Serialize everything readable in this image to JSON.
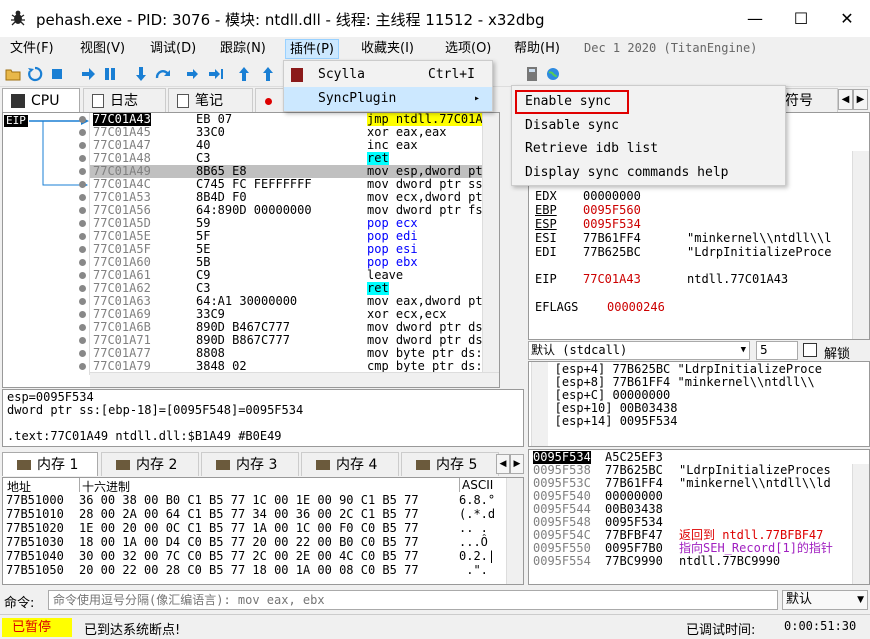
{
  "window": {
    "title": "pehash.exe - PID: 3076 - 模块: ntdll.dll - 线程: 主线程 11512 - x32dbg",
    "min": "—",
    "max": "☐",
    "close": "✕"
  },
  "menu": [
    "文件(F)",
    "视图(V)",
    "调试(D)",
    "跟踪(N)",
    "插件(P)",
    "收藏夹(I)",
    "选项(O)",
    "帮助(H)"
  ],
  "build_date": "Dec 1 2020 (TitanEngine)",
  "plugin_menu": {
    "items": [
      {
        "label": "Scylla",
        "shortcut": "Ctrl+I"
      },
      {
        "label": "SyncPlugin",
        "arrow": "▸"
      }
    ]
  },
  "sync_menu": {
    "items": [
      "Enable sync",
      "Disable sync",
      "Retrieve idb list",
      "Display sync commands help"
    ],
    "highlighted": "Enable sync"
  },
  "tabs": [
    {
      "label": "CPU"
    },
    {
      "label": "日志"
    },
    {
      "label": "笔记"
    },
    {
      "label": "符号"
    }
  ],
  "eip_label": "EIP",
  "disasm": [
    {
      "addr": "77C01A43",
      "bytes": "EB 07",
      "instr": "jmp ntdll.77C01A",
      "eip": true
    },
    {
      "addr": "77C01A45",
      "bytes": "33C0",
      "instr": "xor eax,eax"
    },
    {
      "addr": "77C01A47",
      "bytes": "40",
      "instr": "inc eax"
    },
    {
      "addr": "77C01A48",
      "bytes": "C3",
      "instr": "ret"
    },
    {
      "addr": "77C01A49",
      "bytes": "8B65 E8",
      "instr": "mov esp,dword pt",
      "sel": true
    },
    {
      "addr": "77C01A4C",
      "bytes": "C745 FC FEFFFFFF",
      "instr": "mov dword ptr ss:"
    },
    {
      "addr": "77C01A53",
      "bytes": "8B4D F0",
      "instr": "mov ecx,dword ptr"
    },
    {
      "addr": "77C01A56",
      "bytes": "64:890D 00000000",
      "instr": "mov dword ptr fs:"
    },
    {
      "addr": "77C01A5D",
      "bytes": "59",
      "instr": "pop ecx"
    },
    {
      "addr": "77C01A5E",
      "bytes": "5F",
      "instr": "pop edi"
    },
    {
      "addr": "77C01A5F",
      "bytes": "5E",
      "instr": "pop esi"
    },
    {
      "addr": "77C01A60",
      "bytes": "5B",
      "instr": "pop ebx"
    },
    {
      "addr": "77C01A61",
      "bytes": "C9",
      "instr": "leave"
    },
    {
      "addr": "77C01A62",
      "bytes": "C3",
      "instr": "ret"
    },
    {
      "addr": "77C01A63",
      "bytes": "64:A1 30000000",
      "instr": "mov eax,dword ptr"
    },
    {
      "addr": "77C01A69",
      "bytes": "33C9",
      "instr": "xor ecx,ecx"
    },
    {
      "addr": "77C01A6B",
      "bytes": "890D B467C777",
      "instr": "mov dword ptr ds:"
    },
    {
      "addr": "77C01A71",
      "bytes": "890D B867C777",
      "instr": "mov dword ptr ds:"
    },
    {
      "addr": "77C01A77",
      "bytes": "8808",
      "instr": "mov byte ptr ds:["
    },
    {
      "addr": "77C01A79",
      "bytes": "3848 02",
      "instr": "cmp byte ptr ds:["
    }
  ],
  "info": {
    "line1": "esp=0095F534",
    "line2": "dword ptr ss:[ebp-18]=[0095F548]=0095F534",
    "line3": ".text:77C01A49 ntdll.dll:$B1A49 #B0E49"
  },
  "regs": [
    {
      "name": "EDX",
      "val": "00000000",
      "comment": ""
    },
    {
      "name": "EBP",
      "val": "0095F560",
      "comment": "",
      "red": true
    },
    {
      "name": "ESP",
      "val": "0095F534",
      "comment": "",
      "red": true
    },
    {
      "name": "ESI",
      "val": "77B61FF4",
      "comment": "\"minkernel\\\\ntdll\\\\l"
    },
    {
      "name": "EDI",
      "val": "77B625BC",
      "comment": "\"LdrpInitializeProce"
    },
    {
      "name": "EIP",
      "val": "77C01A43",
      "comment": "ntdll.77C01A43",
      "red": true
    },
    {
      "name": "EFLAGS",
      "val": "00000246",
      "comment": "",
      "red": true
    }
  ],
  "callconv": {
    "label": "默认 (stdcall)",
    "arrow": "▼",
    "count": "5",
    "lock": "解锁"
  },
  "stack_args": [
    "1: [esp+4] 77B625BC \"LdrpInitializeProce",
    "2: [esp+8] 77B61FF4 \"minkernel\\\\ntdll\\\\",
    "3: [esp+C] 00000000",
    "4: [esp+10] 00B03438",
    "5: [esp+14] 0095F534"
  ],
  "mem_tabs": [
    "内存 1",
    "内存 2",
    "内存 3",
    "内存 4",
    "内存 5"
  ],
  "dump": {
    "headers": {
      "addr": "地址",
      "hex": "十六进制",
      "ascii": "ASCII"
    },
    "rows": [
      {
        "addr": "77B51000",
        "hex": "36 00 38 00 B0 C1 B5 77 1C 00 1E 00 90 C1 B5 77",
        "ascii": "6.8.°"
      },
      {
        "addr": "77B51010",
        "hex": "28 00 2A 00 64 C1 B5 77 34 00 36 00 2C C1 B5 77",
        "ascii": "(.*.d"
      },
      {
        "addr": "77B51020",
        "hex": "1E 00 20 00 0C C1 B5 77 1A 00 1C 00 F0 C0 B5 77",
        "ascii": ".. ."
      },
      {
        "addr": "77B51030",
        "hex": "18 00 1A 00 D4 C0 B5 77 20 00 22 00 B0 C0 B5 77",
        "ascii": "...Ô"
      },
      {
        "addr": "77B51040",
        "hex": "30 00 32 00 7C C0 B5 77 2C 00 2E 00 4C C0 B5 77",
        "ascii": "0.2.|"
      },
      {
        "addr": "77B51050",
        "hex": "20 00 22 00 28 C0 B5 77 18 00 1A 00 08 C0 B5 77",
        "ascii": " .\"."
      }
    ]
  },
  "stack": [
    {
      "addr": "0095F534",
      "val": "A5C25EF3",
      "comment": "",
      "top": true
    },
    {
      "addr": "0095F538",
      "val": "77B625BC",
      "comment": "\"LdrpInitializeProces"
    },
    {
      "addr": "0095F53C",
      "val": "77B61FF4",
      "comment": "\"minkernel\\\\ntdll\\\\ld"
    },
    {
      "addr": "0095F540",
      "val": "00000000",
      "comment": ""
    },
    {
      "addr": "0095F544",
      "val": "00B03438",
      "comment": ""
    },
    {
      "addr": "0095F548",
      "val": "0095F534",
      "comment": ""
    },
    {
      "addr": "0095F54C",
      "val": "77BFBF47",
      "comment": "返回到 ntdll.77BFBF47",
      "red": true
    },
    {
      "addr": "0095F550",
      "val": "0095F7B0",
      "comment": "指向SEH_Record[1]的指针",
      "purple": true
    },
    {
      "addr": "0095F554",
      "val": "77BC9990",
      "comment": "ntdll.77BC9990"
    }
  ],
  "cmd": {
    "label": "命令:",
    "placeholder": "命令使用逗号分隔(像汇编语言): mov eax, ebx",
    "default": "默认"
  },
  "status": {
    "paused": "已暂停",
    "msg": "已到达系统断点!",
    "time_label": "已调试时间:",
    "time": "0:00:51:30"
  },
  "colors": {
    "accent": "#c00000",
    "highlight": "#cce8ff",
    "paused": "#ffff00"
  }
}
